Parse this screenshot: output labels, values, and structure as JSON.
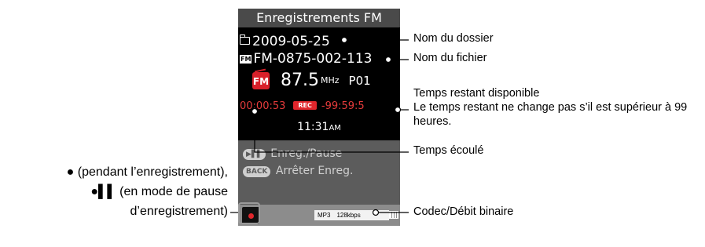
{
  "screen": {
    "title": "Enregistrements FM",
    "folder": "2009-05-25",
    "file": "FM-0875-002-113",
    "file_icon": "FM",
    "band_badge": "FM",
    "frequency": "87.5",
    "frequency_unit": "MHz",
    "preset": "P01",
    "elapsed_time": "00:00:53",
    "rec_badge": "REC",
    "remaining_time": "-99:59:5",
    "clock": "11:31",
    "clock_ampm": "AM",
    "hints": [
      {
        "key": "▶▌▌",
        "text": "Enreg./Pause"
      },
      {
        "key": "BACK",
        "text": "Arrêter Enreg."
      }
    ],
    "codec": "MP3",
    "bitrate": "128kbps"
  },
  "callouts": {
    "folder_name": "Nom du dossier",
    "file_name": "Nom du fichier",
    "remaining_title": "Temps restant disponible",
    "remaining_note": "Le temps restant ne change pas s’il est supérieur à 99 heures.",
    "elapsed": "Temps écoulé",
    "codec_bitrate": "Codec/Débit binaire",
    "rec_line1": "● (pendant l’enregistrement),",
    "rec_line2": "●▌▌ (en mode de pause",
    "rec_line3": "d’enregistrement)"
  },
  "colors": {
    "accent_red": "#e0262c",
    "screen_bg": "#000000",
    "panel_gray": "#5c5c5c"
  },
  "icons": [
    "folder-icon",
    "fm-file-icon",
    "fm-radio-icon",
    "rec-icon",
    "play-pause-icon",
    "back-icon",
    "record-button-icon",
    "battery-icon"
  ]
}
